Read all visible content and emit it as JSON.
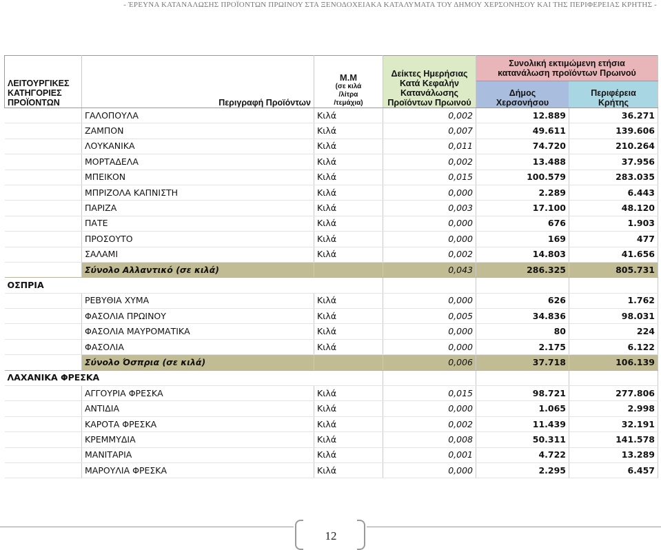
{
  "header": {
    "running_title": "- ΈΡΕΥΝΑ ΚΑΤΑΝΑΛΩΣΗΣ ΠΡΟΪΟΝΤΩΝ ΠΡΩΙΝΟΥ ΣΤΑ ΞΕΝΟΔΟΧΕΙΑΚΑ ΚΑΤΑΛΥΜΑΤΑ ΤΟΥ ΔΗΜΟΥ ΧΕΡΣΟΝΗΣΟΥ ΚΑΙ ΤΗΣ ΠΕΡΙΦΕΡΕΙΑΣ ΚΡΗΤΗΣ -"
  },
  "columns": {
    "category": [
      "ΛΕΙΤΟΥΡΓΙΚΕΣ",
      "ΚΑΤΗΓΟΡΙΕΣ",
      "ΠΡΟΪΟΝΤΩΝ"
    ],
    "description": "Περιγραφή Προϊόντων",
    "unit_main": "Μ.Μ",
    "unit_sub": [
      "(σε κιλά",
      "/λίτρα",
      "/τεμάχια)"
    ],
    "index": [
      "Δείκτες Ημερήσιας",
      "Κατά Κεφαλήν",
      "Κατανάλωσης",
      "Προϊόντων Πρωινού"
    ],
    "group_top": [
      "Συνολική εκτιμώμενη ετήσια",
      "κατανάλωση προϊόντων Πρωινού"
    ],
    "municipality": [
      "Δήμος",
      "Χερσονήσου"
    ],
    "region": [
      "Περιφέρεια",
      "Κρήτης"
    ]
  },
  "sections": [
    {
      "category": "",
      "rows": [
        {
          "name": "ΓΑΛΟΠΟΥΛΑ",
          "unit": "Κιλά",
          "index": "0,002",
          "mun": "12.889",
          "reg": "36.271"
        },
        {
          "name": "ΖΑΜΠΟΝ",
          "unit": "Κιλά",
          "index": "0,007",
          "mun": "49.611",
          "reg": "139.606"
        },
        {
          "name": "ΛΟΥΚΑΝΙΚΑ",
          "unit": "Κιλά",
          "index": "0,011",
          "mun": "74.720",
          "reg": "210.264"
        },
        {
          "name": "ΜΟΡΤΑΔΕΛΑ",
          "unit": "Κιλά",
          "index": "0,002",
          "mun": "13.488",
          "reg": "37.956"
        },
        {
          "name": "ΜΠΕΙΚΟΝ",
          "unit": "Κιλά",
          "index": "0,015",
          "mun": "100.579",
          "reg": "283.035"
        },
        {
          "name": "ΜΠΡΙΖΟΛΑ ΚΑΠΝΙΣΤΗ",
          "unit": "Κιλά",
          "index": "0,000",
          "mun": "2.289",
          "reg": "6.443"
        },
        {
          "name": "ΠΑΡΙΖΑ",
          "unit": "Κιλά",
          "index": "0,003",
          "mun": "17.100",
          "reg": "48.120"
        },
        {
          "name": "ΠΑΤΕ",
          "unit": "Κιλά",
          "index": "0,000",
          "mun": "676",
          "reg": "1.903"
        },
        {
          "name": "ΠΡΟΣΟΥΤΟ",
          "unit": "Κιλά",
          "index": "0,000",
          "mun": "169",
          "reg": "477"
        },
        {
          "name": "ΣΑΛΑΜΙ",
          "unit": "Κιλά",
          "index": "0,002",
          "mun": "14.803",
          "reg": "41.656"
        }
      ],
      "total": {
        "name": "Σύνολο Αλλαντικό (σε κιλά)",
        "index": "0,043",
        "mun": "286.325",
        "reg": "805.731"
      }
    },
    {
      "category": "ΟΣΠΡΙΑ",
      "rows": [
        {
          "name": "ΡΕΒΥΘΙΑ ΧΥΜΑ",
          "unit": "Κιλά",
          "index": "0,000",
          "mun": "626",
          "reg": "1.762"
        },
        {
          "name": "ΦΑΣΟΛΙΑ ΠΡΩΙΝΟΥ",
          "unit": "Κιλά",
          "index": "0,005",
          "mun": "34.836",
          "reg": "98.031"
        },
        {
          "name": "ΦΑΣΟΛΙΑ ΜΑΥΡΟΜΑΤΙΚΑ",
          "unit": "Κιλά",
          "index": "0,000",
          "mun": "80",
          "reg": "224"
        },
        {
          "name": "ΦΑΣΟΛΙΑ",
          "unit": "Κιλά",
          "index": "0,000",
          "mun": "2.175",
          "reg": "6.122"
        }
      ],
      "total": {
        "name": "Σύνολο Όσπρια  (σε κιλά)",
        "index": "0,006",
        "mun": "37.718",
        "reg": "106.139"
      }
    },
    {
      "category": "ΛΑΧΑΝΙΚΑ ΦΡΕΣΚΑ",
      "rows": [
        {
          "name": "ΑΓΓΟΥΡΙΑ ΦΡΕΣΚΑ",
          "unit": "Κιλά",
          "index": "0,015",
          "mun": "98.721",
          "reg": "277.806"
        },
        {
          "name": "ΑΝΤΙΔΙΑ",
          "unit": "Κιλά",
          "index": "0,000",
          "mun": "1.065",
          "reg": "2.998"
        },
        {
          "name": "ΚΑΡΟΤΑ ΦΡΕΣΚΑ",
          "unit": "Κιλά",
          "index": "0,002",
          "mun": "11.439",
          "reg": "32.191"
        },
        {
          "name": "ΚΡΕΜΜΥΔΙΑ",
          "unit": "Κιλά",
          "index": "0,008",
          "mun": "50.311",
          "reg": "141.578"
        },
        {
          "name": "ΜΑΝΙΤΑΡΙΑ",
          "unit": "Κιλά",
          "index": "0,001",
          "mun": "4.722",
          "reg": "13.289"
        },
        {
          "name": "ΜΑΡΟΥΛΙΑ ΦΡΕΣΚΑ",
          "unit": "Κιλά",
          "index": "0,000",
          "mun": "2.295",
          "reg": "6.457"
        }
      ],
      "total": null
    }
  ],
  "footer": {
    "page_number": "12"
  }
}
